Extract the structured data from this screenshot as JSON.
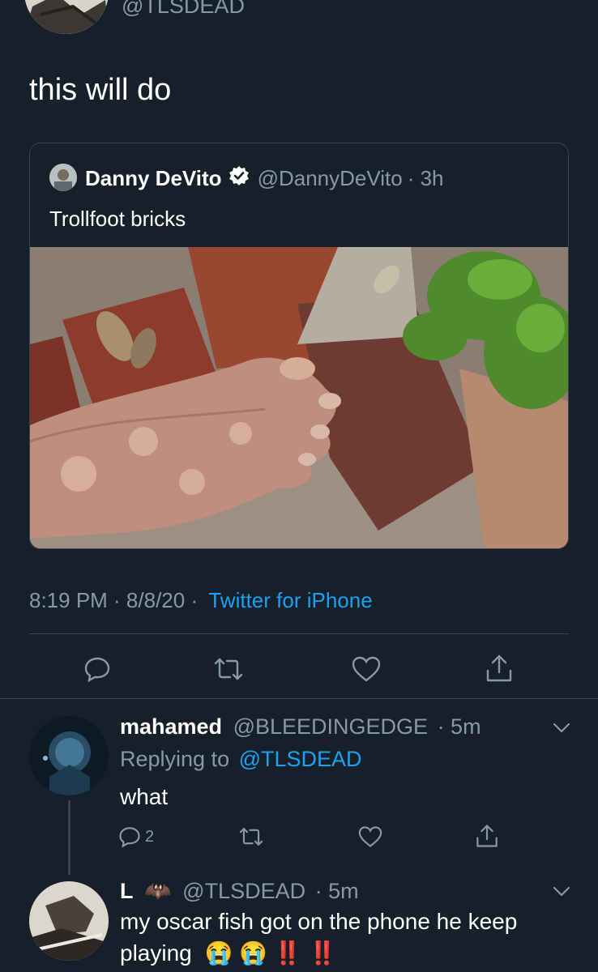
{
  "main_tweet": {
    "handle": "@TLSDEAD",
    "text": "this will do",
    "quoted": {
      "name": "Danny DeVito",
      "handle": "@DannyDeVito",
      "age": "· 3h",
      "text": "Trollfoot bricks",
      "media_alt": "photo"
    },
    "timestamp": "8:19 PM · 8/8/20 ·",
    "source": "Twitter for iPhone",
    "actions": [
      "reply-icon",
      "retweet-icon",
      "like-icon",
      "share-icon"
    ]
  },
  "replies": [
    {
      "name": "mahamed",
      "handle": "@BLEEDINGEDGE",
      "age": "· 5m",
      "replying_label": "Replying to",
      "replying_to": "@TLSDEAD",
      "text": "what",
      "reply_count": "2"
    },
    {
      "name": "L",
      "name_emoji": "🦇",
      "handle": "@TLSDEAD",
      "age": "· 5m",
      "text": "my oscar fish got on the phone he keep",
      "text_line2": "playing",
      "emojis": "😭 😭 ‼️ ‼️"
    }
  ],
  "colors": {
    "background": "#15202b",
    "accent": "#1da1f2",
    "muted": "#8899a6",
    "divider": "#38444d"
  }
}
